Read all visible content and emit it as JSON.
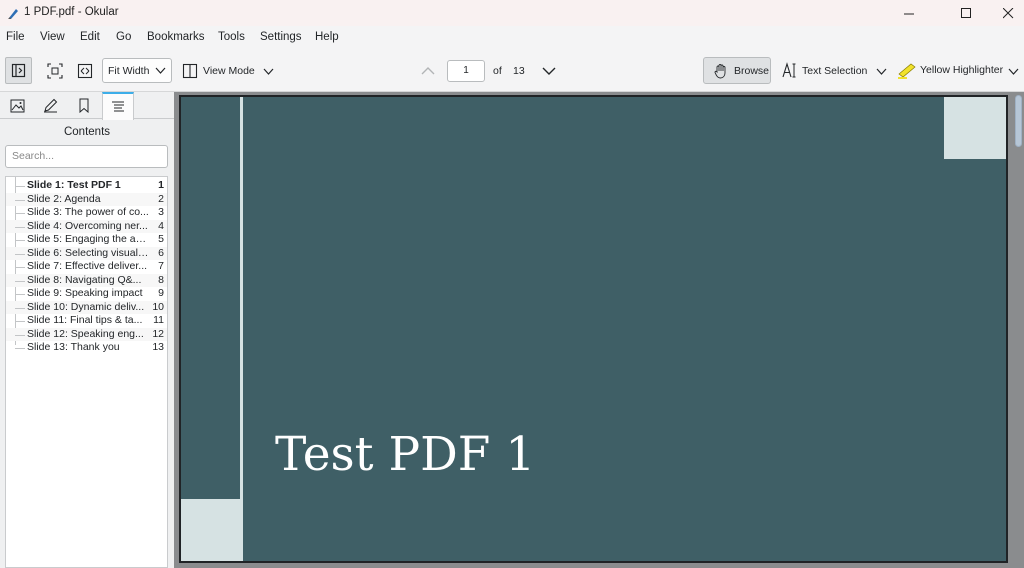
{
  "window": {
    "title": "1 PDF.pdf  - Okular"
  },
  "menu": [
    "File",
    "View",
    "Edit",
    "Go",
    "Bookmarks",
    "Tools",
    "Settings",
    "Help"
  ],
  "toolbar": {
    "zoom_value": "Fit Width",
    "view_mode_label": "View Mode",
    "page_current": "1",
    "page_of_label": "of",
    "page_total": "13",
    "browse_label": "Browse",
    "text_selection_label": "Text Selection",
    "highlighter_label": "Yellow Highlighter"
  },
  "sidebar": {
    "title": "Contents",
    "search_placeholder": "Search...",
    "toc": [
      {
        "title": "Slide 1: Test PDF 1",
        "page": "1"
      },
      {
        "title": "Slide 2: Agenda",
        "page": "2"
      },
      {
        "title": "Slide 3: The power of co...",
        "page": "3"
      },
      {
        "title": "Slide 4: Overcoming ner...",
        "page": "4"
      },
      {
        "title": "Slide 5: Engaging the au...",
        "page": "5"
      },
      {
        "title": "Slide 6: Selecting visual ...",
        "page": "6"
      },
      {
        "title": "Slide 7: Effective deliver...",
        "page": "7"
      },
      {
        "title": "Slide 8: Navigating Q&...",
        "page": "8"
      },
      {
        "title": "Slide 9: Speaking impact",
        "page": "9"
      },
      {
        "title": "Slide 10: Dynamic deliv...",
        "page": "10"
      },
      {
        "title": "Slide 11: Final tips & ta...",
        "page": "11"
      },
      {
        "title": "Slide 12: Speaking eng...",
        "page": "12"
      },
      {
        "title": "Slide 13: Thank you",
        "page": "13"
      }
    ]
  },
  "document": {
    "slide_title": "Test PDF 1"
  },
  "colors": {
    "slide_bg": "#3f5f66",
    "slide_accent": "#d6e2e3",
    "highlight": "#f1e22b",
    "tab_accent": "#3daee9"
  }
}
